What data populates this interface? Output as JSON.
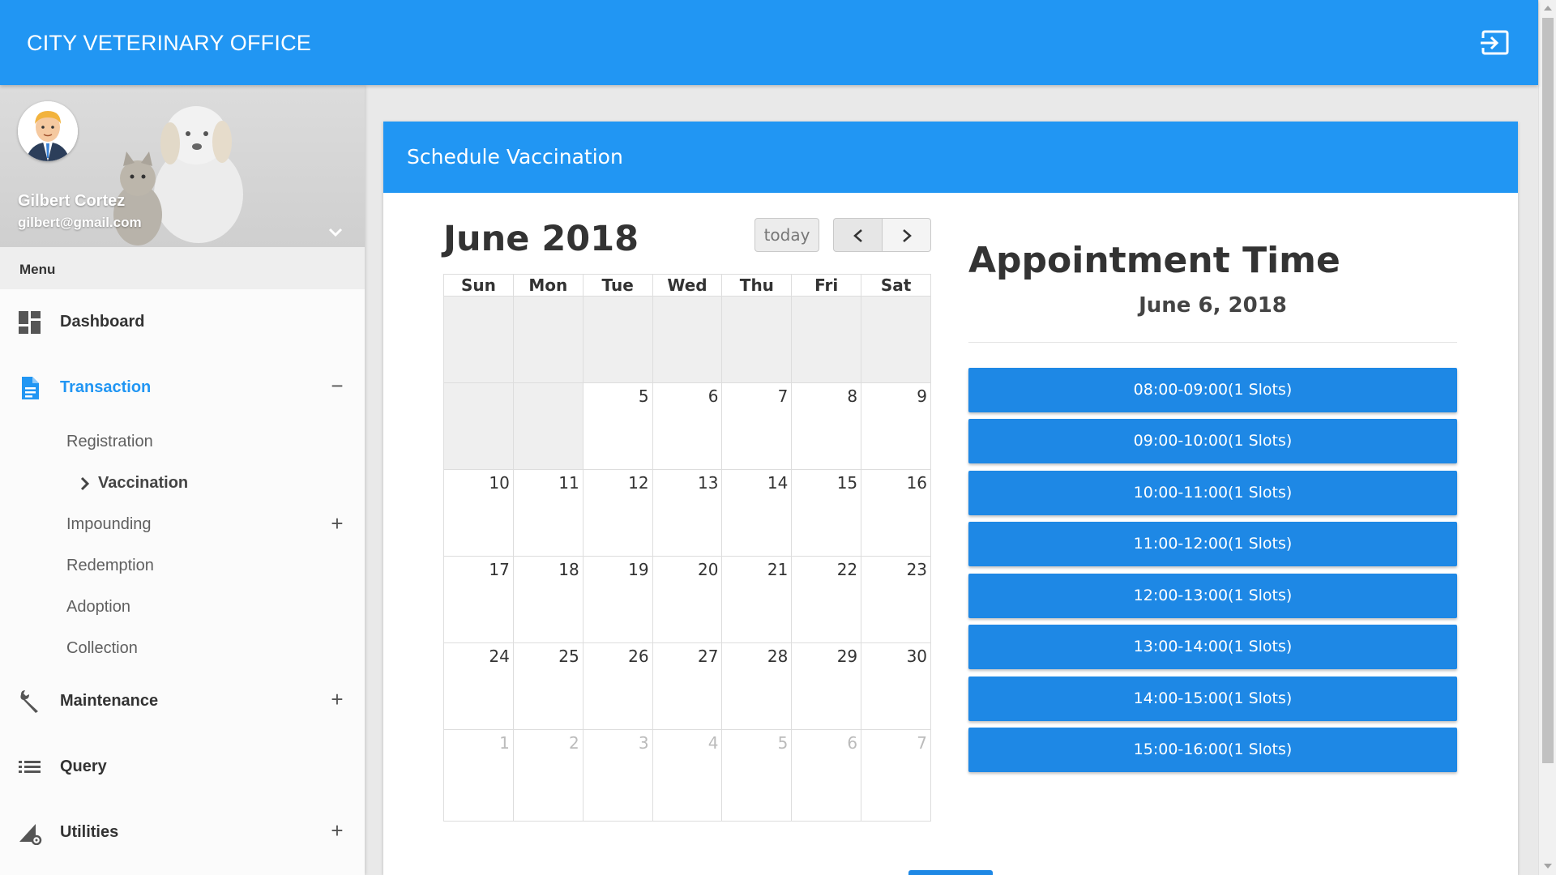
{
  "app": {
    "title": "CITY VETERINARY OFFICE",
    "logout_icon": "logout-icon",
    "accent_color": "#2196f3"
  },
  "user": {
    "name": "Gilbert Cortez",
    "email": "gilbert@gmail.com"
  },
  "menu": {
    "header": "Menu",
    "items": [
      {
        "label": "Dashboard",
        "icon": "dashboard-icon",
        "toggle": ""
      },
      {
        "label": "Transaction",
        "icon": "document-icon",
        "toggle": "−",
        "active": true
      },
      {
        "label": "Maintenance",
        "icon": "wrench-icon",
        "toggle": "+"
      },
      {
        "label": "Query",
        "icon": "list-icon",
        "toggle": ""
      },
      {
        "label": "Utilities",
        "icon": "utilities-icon",
        "toggle": "+"
      }
    ],
    "transaction_sub": [
      {
        "label": "Registration"
      },
      {
        "label": "Vaccination",
        "active": true
      },
      {
        "label": "Impounding",
        "toggle": "+"
      },
      {
        "label": "Redemption"
      },
      {
        "label": "Adoption"
      },
      {
        "label": "Collection"
      }
    ]
  },
  "card": {
    "title": "Schedule Vaccination"
  },
  "calendar": {
    "title": "June 2018",
    "today_label": "today",
    "weekdays": [
      "Sun",
      "Mon",
      "Tue",
      "Wed",
      "Thu",
      "Fri",
      "Sat"
    ],
    "weeks": [
      [
        "",
        "",
        "",
        "",
        "",
        "",
        ""
      ],
      [
        "",
        "",
        "5",
        "6",
        "7",
        "8",
        "9"
      ],
      [
        "10",
        "11",
        "12",
        "13",
        "14",
        "15",
        "16"
      ],
      [
        "17",
        "18",
        "19",
        "20",
        "21",
        "22",
        "23"
      ],
      [
        "24",
        "25",
        "26",
        "27",
        "28",
        "29",
        "30"
      ],
      [
        "1",
        "2",
        "3",
        "4",
        "5",
        "6",
        "7"
      ]
    ]
  },
  "appointment": {
    "title": "Appointment Time",
    "date": "June 6, 2018",
    "slots": [
      "08:00-09:00(1 Slots)",
      "09:00-10:00(1 Slots)",
      "10:00-11:00(1 Slots)",
      "11:00-12:00(1 Slots)",
      "12:00-13:00(1 Slots)",
      "13:00-14:00(1 Slots)",
      "14:00-15:00(1 Slots)",
      "15:00-16:00(1 Slots)"
    ]
  }
}
